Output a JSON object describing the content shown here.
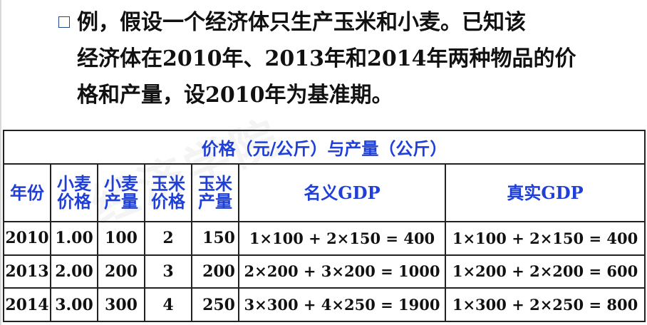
{
  "intro": {
    "line1": "例，假设一个经济体只生产玉米和小麦。已知该",
    "line2": "经济体在2010年、2013年和2014年两种物品的价",
    "line3": "格和产量，设2010年为基准期。"
  },
  "table": {
    "caption": "价格（元/公斤）与产量（公斤）",
    "headers": {
      "year": "年份",
      "wheat_price": [
        "小麦",
        "价格"
      ],
      "wheat_qty": [
        "小麦",
        "产量"
      ],
      "corn_price": [
        "玉米",
        "价格"
      ],
      "corn_qty": [
        "玉米",
        "产量"
      ],
      "nominal_gdp": "名义GDP",
      "real_gdp": "真实GDP"
    },
    "rows": [
      {
        "year": "2010",
        "wheat_price": "1.00",
        "wheat_qty": "100",
        "corn_price": "2",
        "corn_qty": "150",
        "nominal_gdp": "1×100 + 2×150 = 400",
        "real_gdp": "1×100 + 2×150 = 400"
      },
      {
        "year": "2013",
        "wheat_price": "2.00",
        "wheat_qty": "200",
        "corn_price": "3",
        "corn_qty": "200",
        "nominal_gdp": "2×200 + 3×200 = 1000",
        "real_gdp": "1×200 + 2×200 = 600"
      },
      {
        "year": "2014",
        "wheat_price": "3.00",
        "wheat_qty": "300",
        "corn_price": "4",
        "corn_qty": "250",
        "nominal_gdp": "3×300 + 4×250 = 1900",
        "real_gdp": "1×300 + 2×250 = 800"
      }
    ]
  },
  "colors": {
    "header_text": "#1f3fd6",
    "bullet": "#1c4a8a",
    "border": "#222222"
  }
}
